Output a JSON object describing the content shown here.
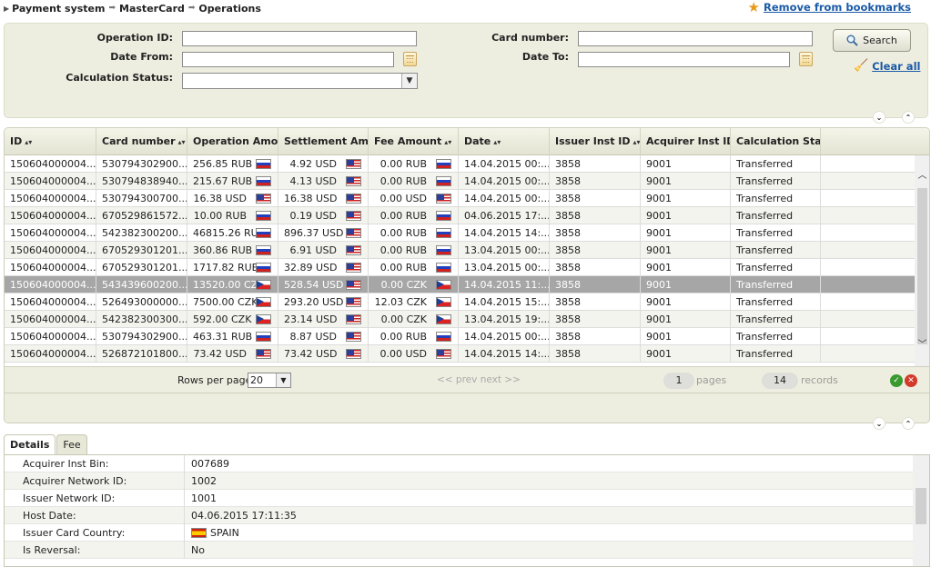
{
  "breadcrumb": [
    "Payment system",
    "MasterCard",
    "Operations"
  ],
  "bookmark_label": "Remove from bookmarks",
  "filter": {
    "operation_id_label": "Operation ID:",
    "operation_id_value": "",
    "date_from_label": "Date From:",
    "date_from_value": "",
    "calc_status_label": "Calculation Status:",
    "calc_status_value": "",
    "card_number_label": "Card number:",
    "card_number_value": "",
    "date_to_label": "Date To:",
    "date_to_value": "",
    "search_label": "Search",
    "clear_label": "Clear all"
  },
  "grid": {
    "columns": [
      "ID",
      "Card number",
      "Operation Amou",
      "Settlement Amo",
      "Fee Amount",
      "Date",
      "Issuer Inst ID",
      "Acquirer Inst ID",
      "Calculation Statu"
    ],
    "rows": [
      {
        "id": "150604000004...",
        "card": "530794302900...",
        "op": "256.85 RUB",
        "op_flag": "ru",
        "set": "4.92 USD",
        "set_flag": "us",
        "fee": "0.00 RUB",
        "fee_flag": "ru",
        "date": "14.04.2015 00:...",
        "iss": "3858",
        "acq": "9001",
        "status": "Transferred"
      },
      {
        "id": "150604000004...",
        "card": "530794838940...",
        "op": "215.67 RUB",
        "op_flag": "ru",
        "set": "4.13 USD",
        "set_flag": "us",
        "fee": "0.00 RUB",
        "fee_flag": "ru",
        "date": "14.04.2015 00:...",
        "iss": "3858",
        "acq": "9001",
        "status": "Transferred"
      },
      {
        "id": "150604000004...",
        "card": "530794300700...",
        "op": "16.38 USD",
        "op_flag": "us",
        "set": "16.38 USD",
        "set_flag": "us",
        "fee": "0.00 USD",
        "fee_flag": "us",
        "date": "14.04.2015 00:...",
        "iss": "3858",
        "acq": "9001",
        "status": "Transferred"
      },
      {
        "id": "150604000004...",
        "card": "670529861572...",
        "op": "10.00 RUB",
        "op_flag": "ru",
        "set": "0.19 USD",
        "set_flag": "us",
        "fee": "0.00 RUB",
        "fee_flag": "ru",
        "date": "04.06.2015 17:...",
        "iss": "3858",
        "acq": "9001",
        "status": "Transferred"
      },
      {
        "id": "150604000004...",
        "card": "542382300200...",
        "op": "46815.26 RUB",
        "op_flag": "ru",
        "set": "896.37 USD",
        "set_flag": "us",
        "fee": "0.00 RUB",
        "fee_flag": "ru",
        "date": "14.04.2015 14:...",
        "iss": "3858",
        "acq": "9001",
        "status": "Transferred"
      },
      {
        "id": "150604000004...",
        "card": "670529301201...",
        "op": "360.86 RUB",
        "op_flag": "ru",
        "set": "6.91 USD",
        "set_flag": "us",
        "fee": "0.00 RUB",
        "fee_flag": "ru",
        "date": "13.04.2015 00:...",
        "iss": "3858",
        "acq": "9001",
        "status": "Transferred"
      },
      {
        "id": "150604000004...",
        "card": "670529301201...",
        "op": "1717.82 RUB",
        "op_flag": "ru",
        "set": "32.89 USD",
        "set_flag": "us",
        "fee": "0.00 RUB",
        "fee_flag": "ru",
        "date": "13.04.2015 00:...",
        "iss": "3858",
        "acq": "9001",
        "status": "Transferred"
      },
      {
        "id": "150604000004...",
        "card": "543439600200...",
        "op": "13520.00 CZK",
        "op_flag": "cz",
        "set": "528.54 USD",
        "set_flag": "us",
        "fee": "0.00 CZK",
        "fee_flag": "cz",
        "date": "14.04.2015 11:...",
        "iss": "3858",
        "acq": "9001",
        "status": "Transferred",
        "selected": true
      },
      {
        "id": "150604000004...",
        "card": "526493000000...",
        "op": "7500.00 CZK",
        "op_flag": "cz",
        "set": "293.20 USD",
        "set_flag": "us",
        "fee": "12.03 CZK",
        "fee_flag": "cz",
        "date": "14.04.2015 15:...",
        "iss": "3858",
        "acq": "9001",
        "status": "Transferred"
      },
      {
        "id": "150604000004...",
        "card": "542382300300...",
        "op": "592.00 CZK",
        "op_flag": "cz",
        "set": "23.14 USD",
        "set_flag": "us",
        "fee": "0.00 CZK",
        "fee_flag": "cz",
        "date": "13.04.2015 19:...",
        "iss": "3858",
        "acq": "9001",
        "status": "Transferred"
      },
      {
        "id": "150604000004...",
        "card": "530794302900...",
        "op": "463.31 RUB",
        "op_flag": "ru",
        "set": "8.87 USD",
        "set_flag": "us",
        "fee": "0.00 RUB",
        "fee_flag": "ru",
        "date": "14.04.2015 00:...",
        "iss": "3858",
        "acq": "9001",
        "status": "Transferred"
      },
      {
        "id": "150604000004...",
        "card": "526872101800...",
        "op": "73.42 USD",
        "op_flag": "us",
        "set": "73.42 USD",
        "set_flag": "us",
        "fee": "0.00 USD",
        "fee_flag": "us",
        "date": "14.04.2015 14:...",
        "iss": "3858",
        "acq": "9001",
        "status": "Transferred"
      }
    ]
  },
  "pager": {
    "rows_per_page_label": "Rows per page",
    "rows_per_page_value": "20",
    "nav_text": "<< prev next >>",
    "pages_value": "1",
    "pages_label": "pages",
    "records_value": "14",
    "records_label": "records"
  },
  "details": {
    "tabs": [
      "Details",
      "Fee"
    ],
    "rows": [
      {
        "label": "Acquirer Inst Bin:",
        "value": "007689"
      },
      {
        "label": "Acquirer Network ID:",
        "value": "1002"
      },
      {
        "label": "Issuer Network ID:",
        "value": "1001"
      },
      {
        "label": "Host Date:",
        "value": "04.06.2015 17:11:35"
      },
      {
        "label": "Issuer Card Country:",
        "value": "SPAIN",
        "flag": "es"
      },
      {
        "label": "Is Reversal:",
        "value": "No"
      }
    ]
  },
  "colors": {
    "panel_bg": "#eeeee0",
    "link": "#1a5aa6",
    "selected_row": "#a6a6a6"
  }
}
